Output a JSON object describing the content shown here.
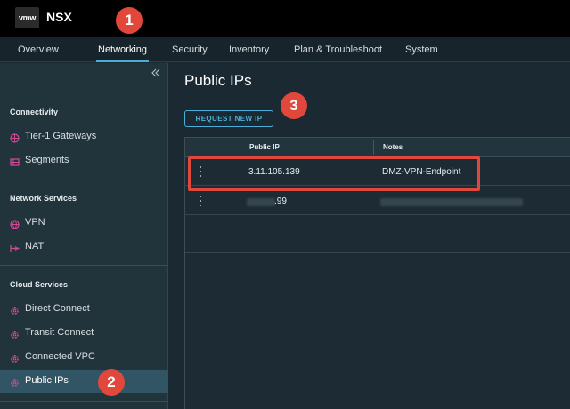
{
  "header": {
    "logo_text": "vmw",
    "app_name": "NSX"
  },
  "nav": {
    "tabs": [
      {
        "label": "Overview"
      },
      {
        "label": "Networking",
        "active": true
      },
      {
        "label": "Security"
      },
      {
        "label": "Inventory"
      },
      {
        "label": "Plan & Troubleshoot"
      },
      {
        "label": "System"
      }
    ]
  },
  "sidebar": {
    "collapse_icon": "double-chevron-left-icon",
    "sections": [
      {
        "heading": "Connectivity",
        "items": [
          {
            "label": "Tier-1 Gateways",
            "icon": "gateway-icon"
          },
          {
            "label": "Segments",
            "icon": "segments-icon"
          }
        ]
      },
      {
        "heading": "Network Services",
        "items": [
          {
            "label": "VPN",
            "icon": "vpn-icon"
          },
          {
            "label": "NAT",
            "icon": "nat-icon"
          }
        ]
      },
      {
        "heading": "Cloud Services",
        "items": [
          {
            "label": "Direct Connect",
            "icon": "gear-icon"
          },
          {
            "label": "Transit Connect",
            "icon": "gear-icon"
          },
          {
            "label": "Connected VPC",
            "icon": "gear-icon"
          },
          {
            "label": "Public IPs",
            "icon": "gear-icon",
            "active": true
          }
        ]
      }
    ]
  },
  "main": {
    "title": "Public IPs",
    "request_button": "REQUEST NEW IP",
    "table": {
      "columns": [
        "Public IP",
        "Notes"
      ],
      "rows": [
        {
          "public_ip": "3.11.105.139",
          "notes": "DMZ-VPN-Endpoint"
        },
        {
          "public_ip": ".99",
          "notes": ""
        }
      ]
    }
  },
  "annotations": {
    "badges": [
      "1",
      "2",
      "3"
    ],
    "color": "#e2473b"
  },
  "colors": {
    "accent": "#49afd9",
    "active_item_bg": "#325566",
    "icon_magenta": "#d14b95"
  }
}
